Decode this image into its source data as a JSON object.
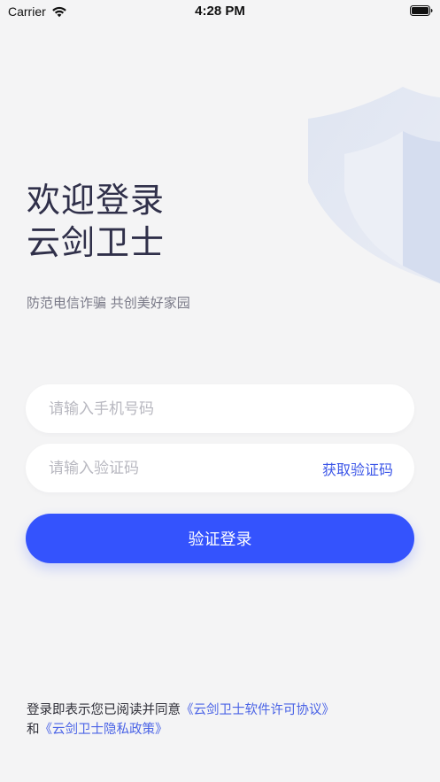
{
  "status_bar": {
    "carrier": "Carrier",
    "time": "4:28 PM"
  },
  "welcome": {
    "line1": "欢迎登录",
    "line2": "云剑卫士"
  },
  "slogan": "防范电信诈骗 共创美好家园",
  "phone_input": {
    "placeholder": "请输入手机号码",
    "value": ""
  },
  "code_input": {
    "placeholder": "请输入验证码",
    "value": ""
  },
  "get_code_label": "获取验证码",
  "login_label": "验证登录",
  "agreement": {
    "prefix": "登录即表示您已阅读并同意",
    "license_link": "《云剑卫士软件许可协议》",
    "and": "和",
    "privacy_link": "《云剑卫士隐私政策》"
  },
  "colors": {
    "accent": "#3453fd",
    "link": "#4a63e6",
    "background": "#f4f4f5",
    "title": "#30304a"
  },
  "icons": [
    "wifi-icon",
    "battery-icon",
    "shield-icon"
  ]
}
